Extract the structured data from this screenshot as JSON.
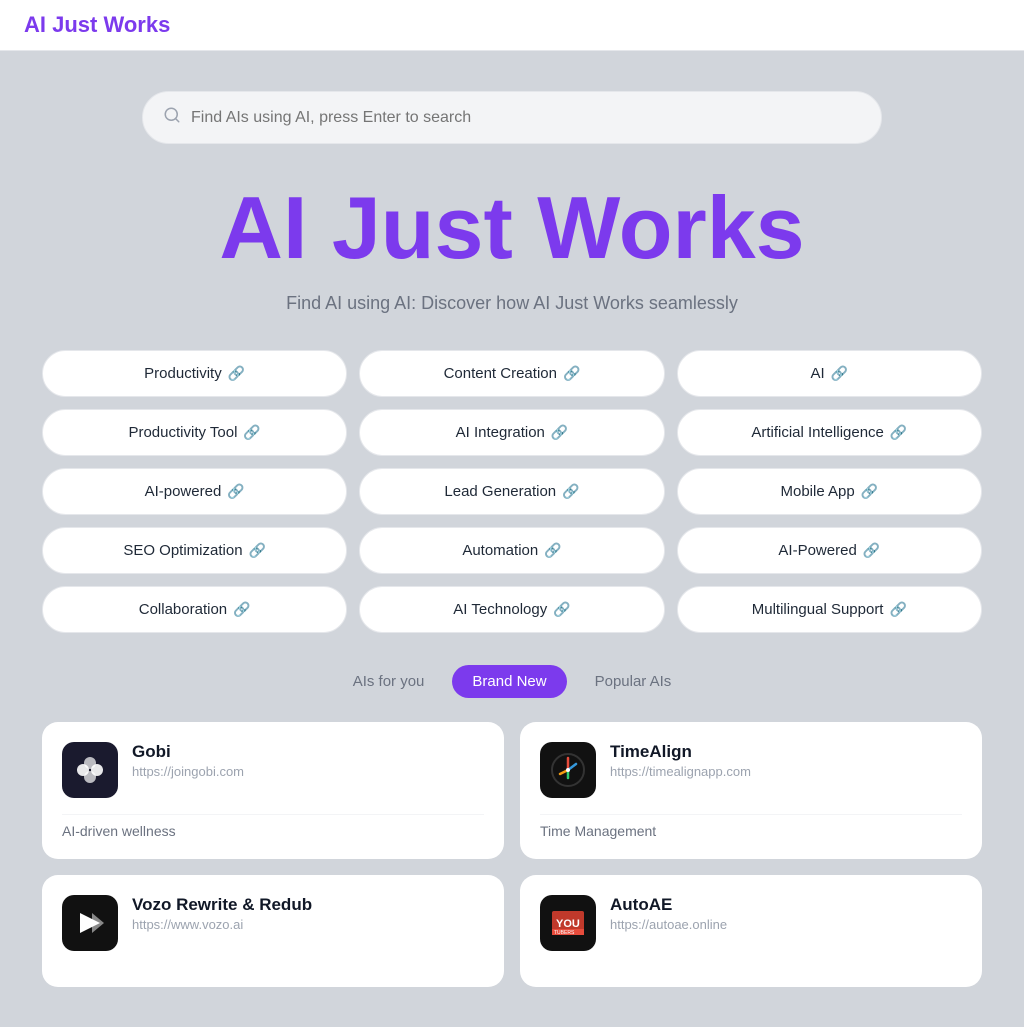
{
  "header": {
    "logo": "AI Just Works"
  },
  "search": {
    "placeholder": "Find AIs using AI, press Enter to search"
  },
  "hero": {
    "title": "AI Just Works",
    "subtitle": "Find AI using AI: Discover how AI Just Works seamlessly"
  },
  "tags": [
    {
      "id": "productivity",
      "label": "Productivity",
      "col": 1
    },
    {
      "id": "content-creation",
      "label": "Content Creation",
      "col": 2
    },
    {
      "id": "ai",
      "label": "AI",
      "col": 3
    },
    {
      "id": "productivity-tool",
      "label": "Productivity Tool",
      "col": 1
    },
    {
      "id": "ai-integration",
      "label": "AI Integration",
      "col": 2
    },
    {
      "id": "artificial-intelligence",
      "label": "Artificial Intelligence",
      "col": 3
    },
    {
      "id": "ai-powered",
      "label": "AI-powered",
      "col": 1
    },
    {
      "id": "lead-generation",
      "label": "Lead Generation",
      "col": 2
    },
    {
      "id": "mobile-app",
      "label": "Mobile App",
      "col": 3
    },
    {
      "id": "seo-optimization",
      "label": "SEO Optimization",
      "col": 1
    },
    {
      "id": "automation",
      "label": "Automation",
      "col": 2
    },
    {
      "id": "ai-powered-2",
      "label": "AI-Powered",
      "col": 3
    },
    {
      "id": "collaboration",
      "label": "Collaboration",
      "col": 1
    },
    {
      "id": "ai-technology",
      "label": "AI Technology",
      "col": 2
    },
    {
      "id": "multilingual-support",
      "label": "Multilingual Support",
      "col": 3
    }
  ],
  "filter_tabs": [
    {
      "id": "ais-for-you",
      "label": "AIs for you",
      "active": false
    },
    {
      "id": "brand-new",
      "label": "Brand New",
      "active": true
    },
    {
      "id": "popular-ais",
      "label": "Popular AIs",
      "active": false
    }
  ],
  "cards": [
    {
      "id": "gobi",
      "name": "Gobi",
      "url": "https://joingobi.com",
      "description": "AI-driven wellness",
      "logo_bg": "#1a1a2e",
      "logo_type": "gobi"
    },
    {
      "id": "timealign",
      "name": "TimeAlign",
      "url": "https://timealignapp.com",
      "description": "Time Management",
      "logo_bg": "#111",
      "logo_type": "timealign"
    },
    {
      "id": "vozo",
      "name": "Vozo Rewrite & Redub",
      "url": "https://www.vozo.ai",
      "description": "",
      "logo_bg": "#111",
      "logo_type": "vozo"
    },
    {
      "id": "autoae",
      "name": "AutoAE",
      "url": "https://autoae.online",
      "description": "",
      "logo_bg": "#111",
      "logo_type": "autoae"
    }
  ]
}
